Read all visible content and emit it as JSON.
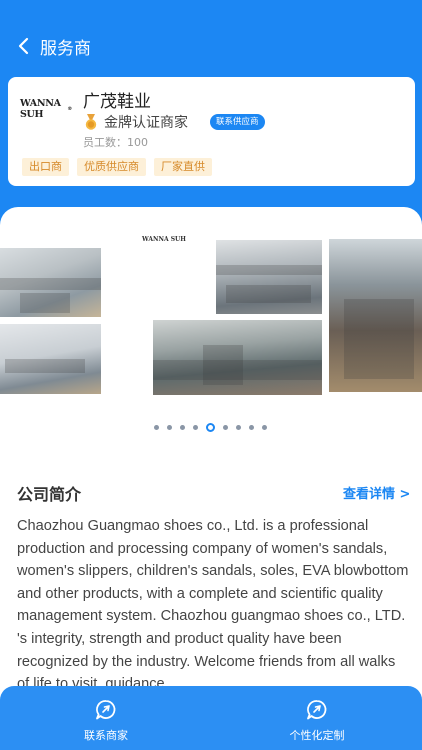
{
  "nav": {
    "title": "服务商"
  },
  "company": {
    "logo_text": "WANNA SUH",
    "logo_mark": "®",
    "name": "广茂鞋业",
    "certification": "金牌认证商家",
    "contact_badge": "联系供应商",
    "staff": "员工数：100",
    "tags": [
      "出口商",
      "优质供应商",
      "厂家直供"
    ]
  },
  "gallery": {
    "brand_text": "WANNA SUH",
    "page_count": 9,
    "active_index": 4
  },
  "intro": {
    "title": "公司简介",
    "more": "查看详情 >",
    "text": "Chaozhou Guangmao shoes co., Ltd. is a professional production and processing company of women's sandals, women's slippers, children's sandals, soles, EVA blowbottom and other products, with a complete and scientific quality management system. Chaozhou guangmao shoes co., LTD. 's integrity, strength and product quality have been recognized by the industry. Welcome friends from all walks of life to visit, guidance"
  },
  "bottom_bar": {
    "contact": "联系商家",
    "custom": "个性化定制"
  },
  "colors": {
    "primary": "#1c87f3",
    "tag_bg": "#fdf0d8",
    "tag_text": "#d68a2a"
  }
}
